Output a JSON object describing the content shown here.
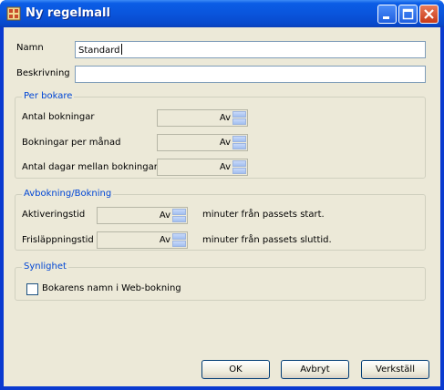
{
  "window": {
    "title": "Ny regelmall"
  },
  "form": {
    "name_label": "Namn",
    "name_value": "Standard",
    "desc_label": "Beskrivning",
    "desc_value": ""
  },
  "per_bokare": {
    "legend": "Per bokare",
    "rows": [
      {
        "label": "Antal bokningar",
        "value": "Av"
      },
      {
        "label": "Bokningar per månad",
        "value": "Av"
      },
      {
        "label": "Antal dagar mellan bokningar",
        "value": "Av"
      }
    ]
  },
  "avbokning": {
    "legend": "Avbokning/Bokning",
    "rows": [
      {
        "label": "Aktiveringstid",
        "value": "Av",
        "suffix": "minuter från passets start."
      },
      {
        "label": "Frisläppningstid",
        "value": "Av",
        "suffix": "minuter från passets sluttid."
      }
    ]
  },
  "synlighet": {
    "legend": "Synlighet",
    "checkbox_label": "Bokarens namn i Web-bokning",
    "checked": false
  },
  "buttons": {
    "ok": "OK",
    "cancel": "Avbryt",
    "apply": "Verkställ"
  },
  "colors": {
    "titlebar": "#0a55dc",
    "dialog_bg": "#ece9d8",
    "legend": "#0046d5",
    "field_border": "#7f9db9"
  },
  "icons": [
    "app-icon",
    "minimize-icon",
    "maximize-icon",
    "close-icon",
    "spin-up-icon",
    "spin-down-icon"
  ]
}
